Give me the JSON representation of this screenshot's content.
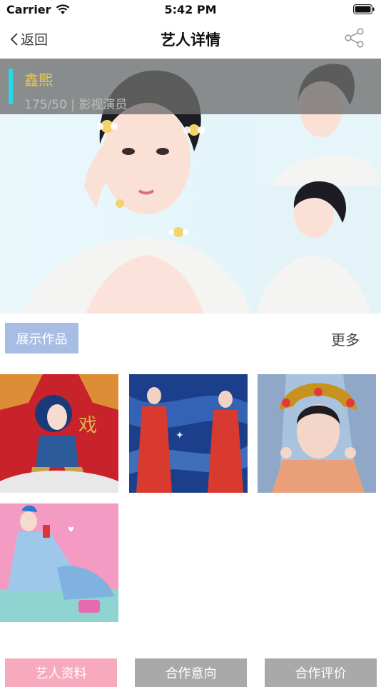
{
  "status_bar": {
    "carrier": "Carrier",
    "time": "5:42 PM"
  },
  "nav": {
    "back_label": "返回",
    "title": "艺人详情"
  },
  "artist": {
    "name": "鑫熙",
    "meta": "175/50 | 影视演员"
  },
  "works_section": {
    "tab_label": "展示作品",
    "more_label": "更多"
  },
  "works": [
    {
      "alt": "red-stage-costume-photo"
    },
    {
      "alt": "blue-sequin-gown-photo"
    },
    {
      "alt": "headdress-portrait-photo"
    },
    {
      "alt": "pastel-blue-dress-photo"
    }
  ],
  "bottom_tabs": [
    {
      "label": "艺人资料",
      "color": "#f7a9bd"
    },
    {
      "label": "合作意向",
      "color": "#a9a9a9"
    },
    {
      "label": "合作评价",
      "color": "#a9a9a9"
    }
  ],
  "colors": {
    "accent": "#28d8e6",
    "name": "#f0c94a",
    "tab": "#a8bde3"
  }
}
